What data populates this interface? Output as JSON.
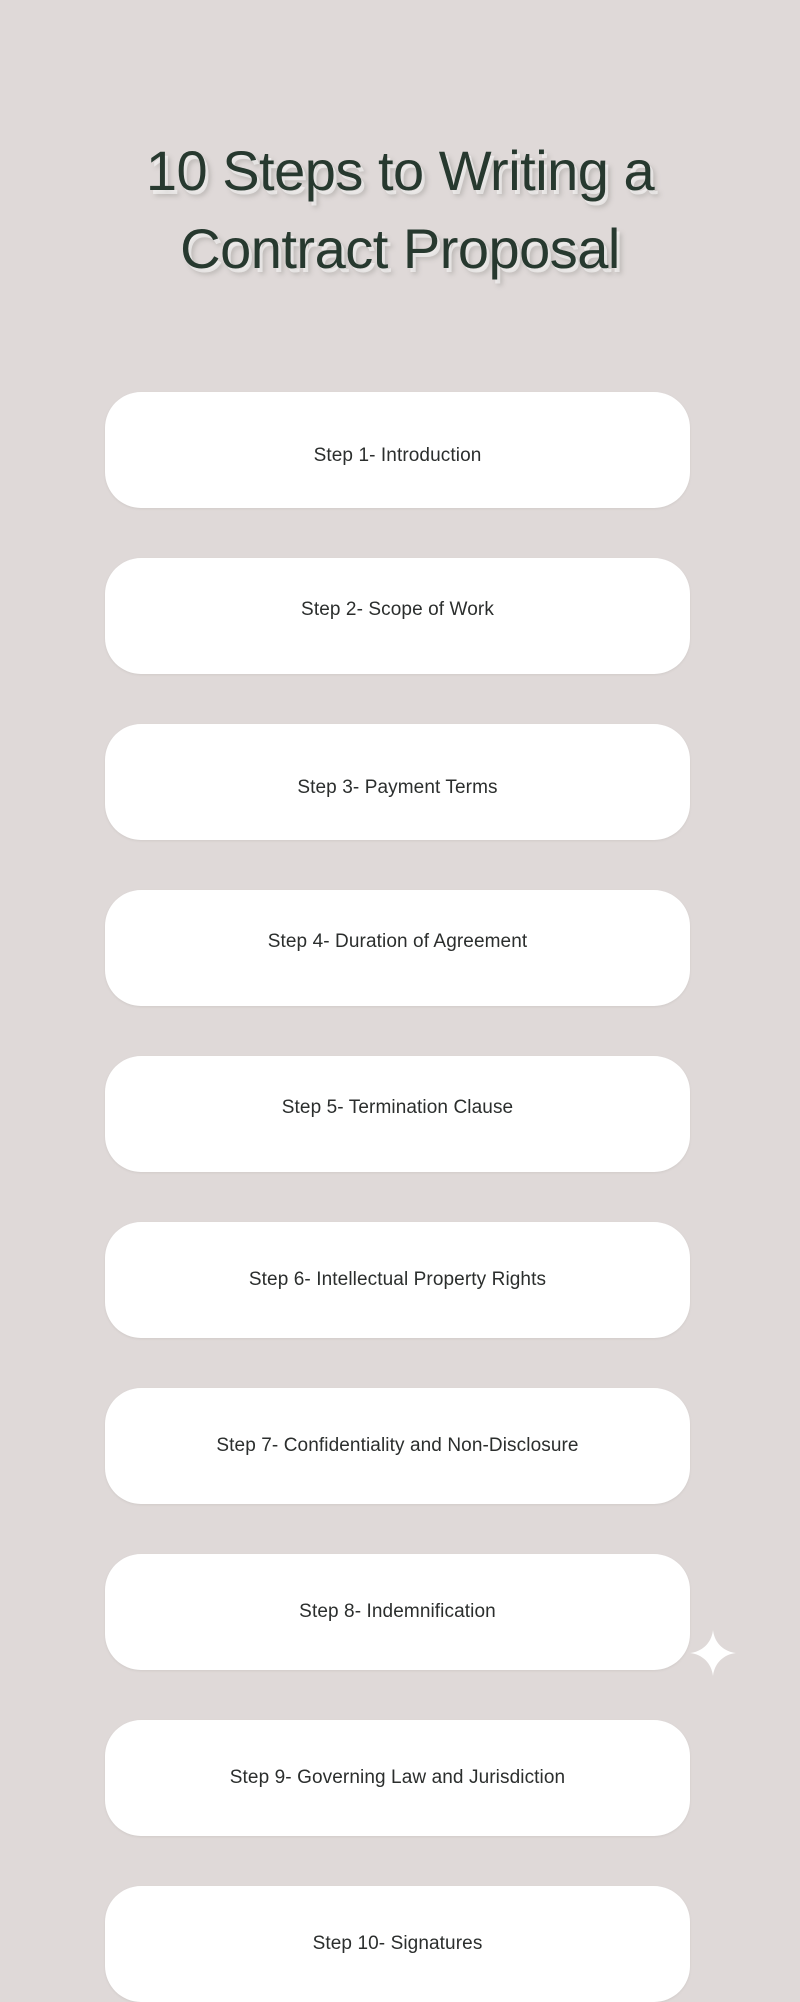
{
  "background_color": "#dfd9d8",
  "title": {
    "line1": "10 Steps to Writing a",
    "line2": "Contract Proposal",
    "full": "10 Steps to Writing a Contract Proposal",
    "color": "#27392f"
  },
  "card": {
    "background_color": "#ffffff",
    "text_color": "#2b2e2d"
  },
  "decoration": {
    "sparkle_icon": "sparkle-icon",
    "color": "#ffffff"
  },
  "steps": [
    {
      "label": "Step 1- Introduction"
    },
    {
      "label": "Step 2- Scope of Work"
    },
    {
      "label": "Step 3- Payment Terms"
    },
    {
      "label": "Step 4- Duration of Agreement"
    },
    {
      "label": "Step 5- Termination Clause"
    },
    {
      "label": "Step 6- Intellectual Property Rights"
    },
    {
      "label": "Step 7- Confidentiality and Non-Disclosure"
    },
    {
      "label": "Step 8- Indemnification"
    },
    {
      "label": "Step 9- Governing Law and Jurisdiction"
    },
    {
      "label": "Step 10- Signatures"
    }
  ]
}
